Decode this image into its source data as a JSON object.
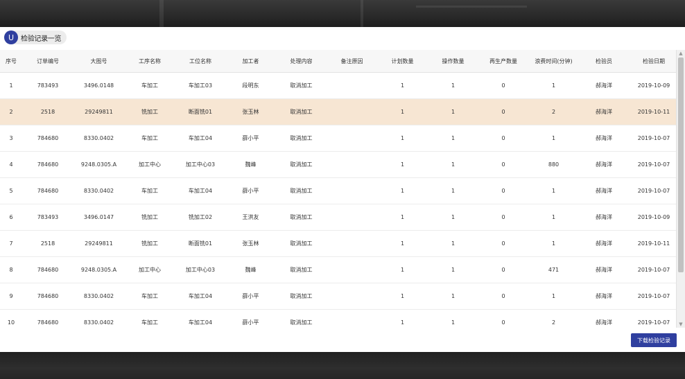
{
  "header": {
    "logo_letter": "U",
    "title": "检验记录一览"
  },
  "table": {
    "columns": [
      "序号",
      "订单编号",
      "大图号",
      "工序名称",
      "工位名称",
      "加工者",
      "处理内容",
      "备注原因",
      "计划数量",
      "操作数量",
      "再生产数量",
      "浪费时间(分钟)",
      "检验员",
      "检验日期"
    ],
    "rows": [
      [
        "1",
        "783493",
        "3496.0148",
        "车加工",
        "车加工03",
        "段明东",
        "取消加工",
        "",
        "1",
        "1",
        "0",
        "1",
        "郝海洋",
        "2019-10-09"
      ],
      [
        "2",
        "2518",
        "29249811",
        "铣加工",
        "断面铣01",
        "张玉林",
        "取消加工",
        "",
        "1",
        "1",
        "0",
        "2",
        "郝海洋",
        "2019-10-11"
      ],
      [
        "3",
        "784680",
        "8330.0402",
        "车加工",
        "车加工04",
        "薛小平",
        "取消加工",
        "",
        "1",
        "1",
        "0",
        "1",
        "郝海洋",
        "2019-10-07"
      ],
      [
        "4",
        "784680",
        "9248.0305.A",
        "加工中心",
        "加工中心03",
        "魏峰",
        "取消加工",
        "",
        "1",
        "1",
        "0",
        "880",
        "郝海洋",
        "2019-10-07"
      ],
      [
        "5",
        "784680",
        "8330.0402",
        "车加工",
        "车加工04",
        "薛小平",
        "取消加工",
        "",
        "1",
        "1",
        "0",
        "1",
        "郝海洋",
        "2019-10-07"
      ],
      [
        "6",
        "783493",
        "3496.0147",
        "铣加工",
        "铣加工02",
        "王洪友",
        "取消加工",
        "",
        "1",
        "1",
        "0",
        "1",
        "郝海洋",
        "2019-10-09"
      ],
      [
        "7",
        "2518",
        "29249811",
        "铣加工",
        "断面铣01",
        "张玉林",
        "取消加工",
        "",
        "1",
        "1",
        "0",
        "1",
        "郝海洋",
        "2019-10-11"
      ],
      [
        "8",
        "784680",
        "9248.0305.A",
        "加工中心",
        "加工中心03",
        "魏峰",
        "取消加工",
        "",
        "1",
        "1",
        "0",
        "471",
        "郝海洋",
        "2019-10-07"
      ],
      [
        "9",
        "784680",
        "8330.0402",
        "车加工",
        "车加工04",
        "薛小平",
        "取消加工",
        "",
        "1",
        "1",
        "0",
        "1",
        "郝海洋",
        "2019-10-07"
      ],
      [
        "10",
        "784680",
        "8330.0402",
        "车加工",
        "车加工04",
        "薛小平",
        "取消加工",
        "",
        "1",
        "1",
        "0",
        "2",
        "郝海洋",
        "2019-10-07"
      ]
    ],
    "selected_row": 1
  },
  "actions": {
    "download_label": "下载检验记录"
  },
  "icons": {
    "scroll_up": "scroll-up-icon",
    "scroll_down": "scroll-down-icon"
  },
  "colors": {
    "accent": "#2f3f9f",
    "selected_row": "#f7e6d3"
  }
}
